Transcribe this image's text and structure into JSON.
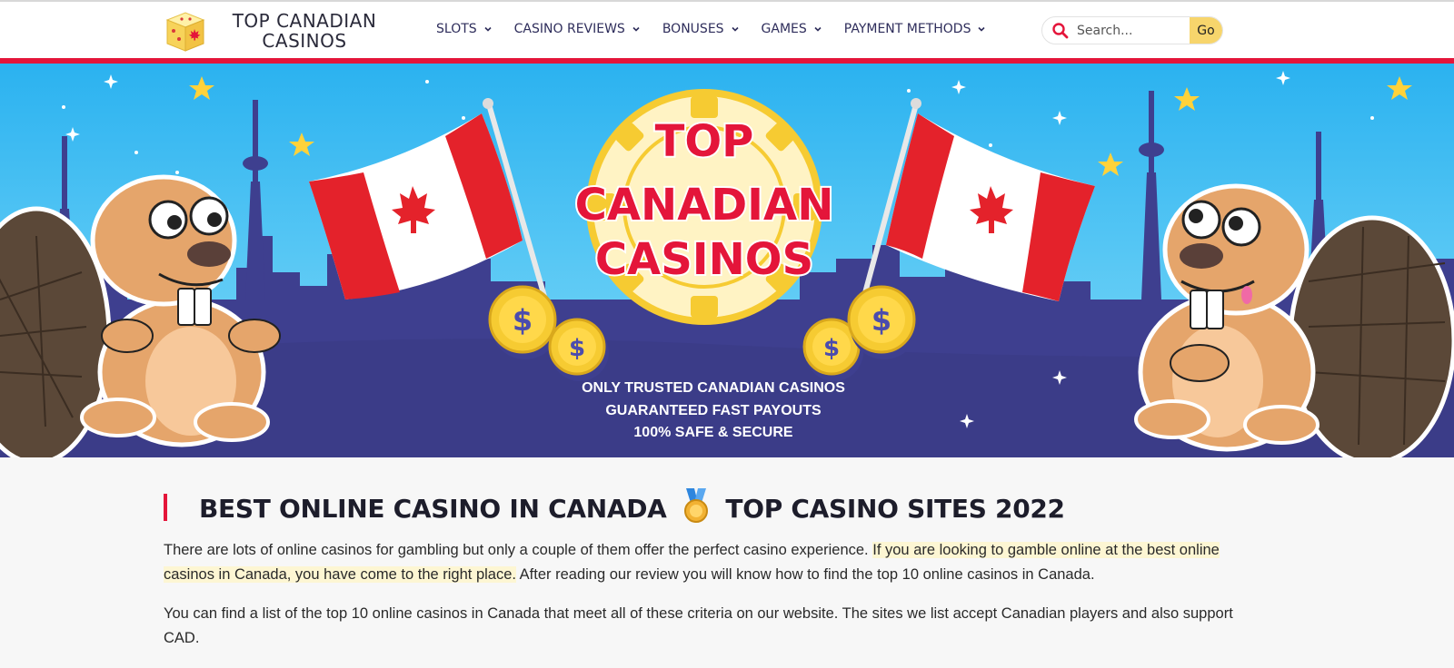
{
  "header": {
    "logo_line1": "TOP CANADIAN",
    "logo_line2": "CASINOS",
    "logo_icon": "dice-maple-leaf-icon",
    "nav": [
      {
        "label": "SLOTS"
      },
      {
        "label": "CASINO REVIEWS"
      },
      {
        "label": "BONUSES"
      },
      {
        "label": "GAMES"
      },
      {
        "label": "PAYMENT METHODS"
      }
    ],
    "search": {
      "placeholder": "Search...",
      "button": "Go"
    }
  },
  "hero": {
    "chip_line1": "TOP",
    "chip_line2": "CANADIAN",
    "chip_line3": "CASINOS",
    "taglines": [
      "ONLY TRUSTED CANADIAN CASINOS",
      "GUARANTEED FAST PAYOUTS",
      "100% SAFE & SECURE"
    ],
    "coin_symbol": "$"
  },
  "main": {
    "heading_part1": "BEST ONLINE CASINO IN CANADA",
    "heading_part2": "TOP CASINO SITES 2022",
    "para1_start": "There are lots of online casinos for gambling but only a couple of them offer the perfect casino experience.",
    "para1_highlight": "If you are looking to gamble online at the best online casinos in Canada, you have come to the right place.",
    "para1_end": "After reading our review you will know how to find the top 10 online casinos in Canada.",
    "para2": "You can find a list of the top 10 online casinos in Canada that meet all of these criteria on our website. The sites we list accept Canadian players and also support CAD."
  },
  "colors": {
    "accent_red": "#e4153a",
    "nav_text": "#2e2d5b",
    "sky": "#2bb2f0",
    "city": "#3e3f8f",
    "gold": "#f6cb32",
    "go_button": "#f7d56c"
  }
}
